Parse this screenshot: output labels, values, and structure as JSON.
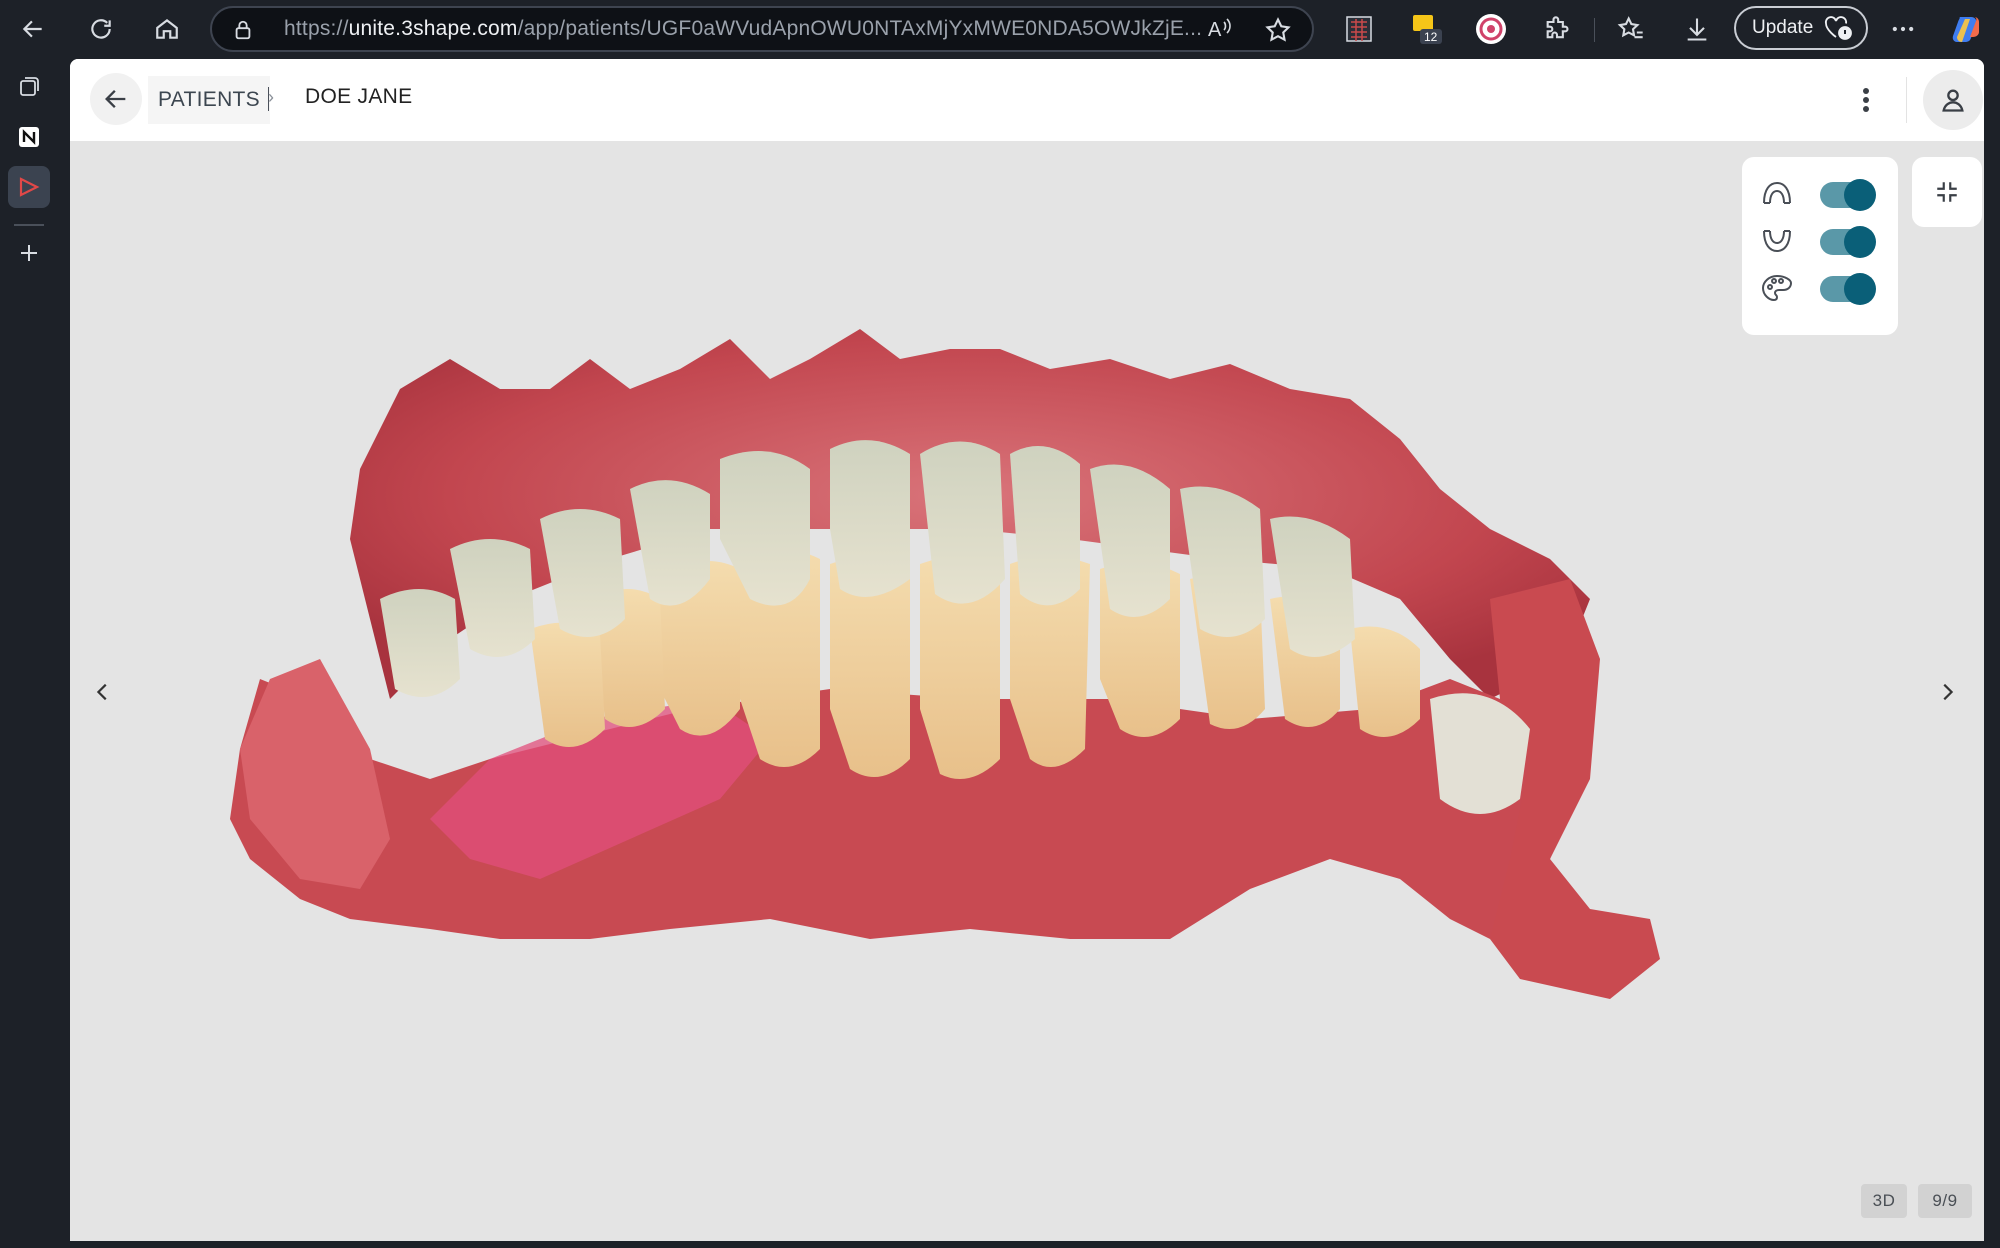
{
  "browser": {
    "url_prefix": "https://",
    "url_host": "unite.3shape.com",
    "url_rest": "/app/patients/UGF0aWVudApnOWU0NTAxMjYxMWE0NDA5OWJkZjE...",
    "update_label": "Update",
    "extension_badge": "12",
    "read_aloud_glyph": "A"
  },
  "header": {
    "breadcrumb_patients": "PATIENTS",
    "breadcrumb_separator": "›",
    "breadcrumb_current": "DOE JANE"
  },
  "viewer": {
    "toggles": [
      {
        "icon": "upper-jaw-icon",
        "state": "on"
      },
      {
        "icon": "lower-jaw-icon",
        "state": "on"
      },
      {
        "icon": "palette-icon",
        "state": "on"
      }
    ],
    "mode_badge": "3D",
    "page_badge": "9/9"
  },
  "colors": {
    "accent": "#0a5f78",
    "switch_track": "#5a98a8",
    "viewer_bg": "#e4e4e4",
    "chrome_bg": "#1d2128"
  }
}
